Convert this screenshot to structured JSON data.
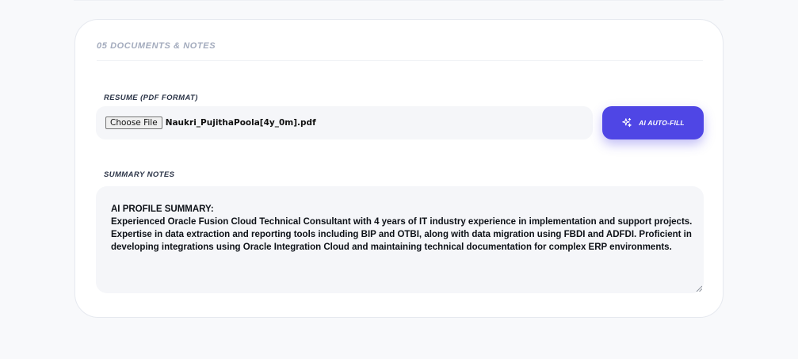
{
  "section": {
    "title": "05 Documents & Notes"
  },
  "resume": {
    "label": "Resume (PDF Format)",
    "choose_file_label": "Choose File",
    "file_name": "Naukri_PujithaPoola[4y_0m].pdf"
  },
  "ai_button": {
    "label": "AI Auto-Fill",
    "icon": "sparkles-icon",
    "color": "#4f46e5"
  },
  "notes": {
    "label": "Summary Notes",
    "lines": [
      "AI PROFILE SUMMARY:",
      "Experienced Oracle Fusion Cloud Technical Consultant with 4 years of IT industry experience in implementation and support projects.",
      "Expertise in data extraction and reporting tools including BIP and OTBI, along with data migration using FBDI and ADFDI. Proficient in",
      "developing integrations using Oracle Integration Cloud and maintaining technical documentation for complex ERP environments."
    ]
  }
}
